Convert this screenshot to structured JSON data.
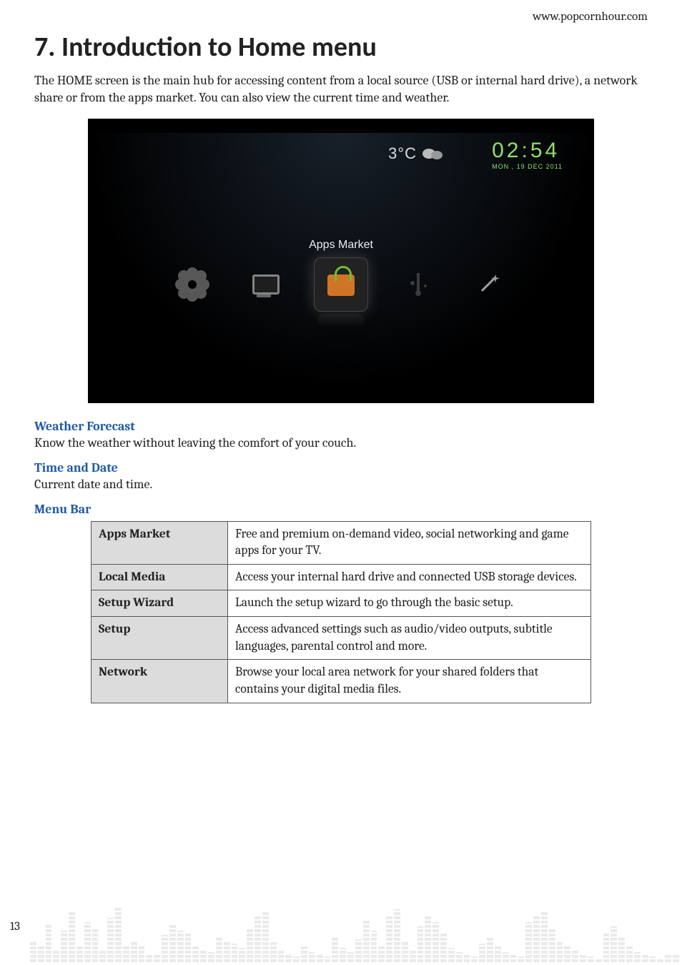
{
  "header": {
    "url": "www.popcornhour.com"
  },
  "title": "7. Introduction to Home menu",
  "intro": "The HOME screen is the main hub for accessing content from a local source (USB or internal hard drive), a network share or from the apps market. You can also view the current time and weather.",
  "screenshot": {
    "weather_temp": "3°C",
    "time": "02:54",
    "date": "MON , 19 DEC 2011",
    "selected_label": "Apps Market",
    "items": [
      {
        "key": "setup",
        "icon": "gear-icon"
      },
      {
        "key": "local-media",
        "icon": "tv-icon"
      },
      {
        "key": "apps-market",
        "icon": "shop-icon",
        "selected": true
      },
      {
        "key": "usb",
        "icon": "usb-icon"
      },
      {
        "key": "wizard",
        "icon": "wand-icon"
      }
    ]
  },
  "sections": {
    "weather": {
      "heading": "Weather Forecast",
      "text": "Know the weather without leaving the comfort of your couch."
    },
    "timedate": {
      "heading": "Time and Date",
      "text": "Current date and time."
    },
    "menubar": {
      "heading": "Menu Bar"
    }
  },
  "menu_table": [
    {
      "name": "Apps Market",
      "desc": "Free and premium on-demand video, social networking and game apps for your TV."
    },
    {
      "name": "Local Media",
      "desc": "Access your internal hard drive and connected USB storage devices."
    },
    {
      "name": "Setup Wizard",
      "desc": "Launch the setup wizard to go through the basic setup."
    },
    {
      "name": "Setup",
      "desc": "Access advanced settings such as audio/video outputs, subtitle languages, parental control and more."
    },
    {
      "name": "Network",
      "desc": "Browse your local area network for your shared folders that contains your digital media files."
    }
  ],
  "page_number": "13"
}
